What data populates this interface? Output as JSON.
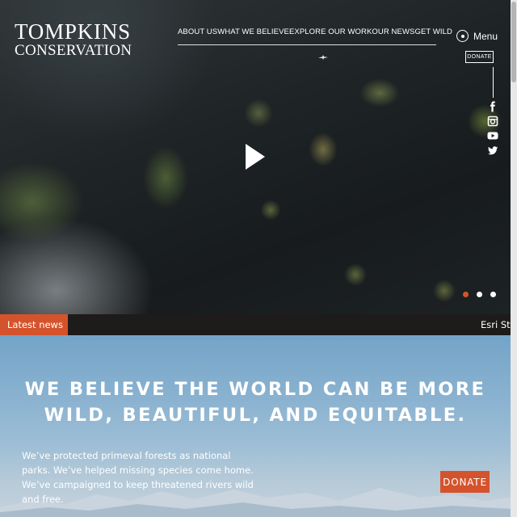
{
  "logo": {
    "line1": "TOMPKINS",
    "line2": "CONSERVATION"
  },
  "nav": {
    "items": [
      "ABOUT US",
      "WHAT WE BELIEVE",
      "EXPLORE OUR WORK",
      "OUR NEWS",
      "GET WILD"
    ]
  },
  "menu": {
    "label": "Menu"
  },
  "header_donate": {
    "label": "DONATE"
  },
  "social": {
    "icons": [
      "facebook-icon",
      "instagram-icon",
      "youtube-icon",
      "twitter-icon"
    ]
  },
  "hero": {
    "play_icon": "play-icon",
    "slides_total": 3,
    "active_slide": 1
  },
  "news": {
    "label": "Latest news",
    "ticker": "Esri St"
  },
  "intro": {
    "headline_line1": "WE BELIEVE THE WORLD CAN BE MORE",
    "headline_line2": "WILD, BEAUTIFUL, AND EQUITABLE.",
    "body": "We’ve protected primeval forests as national parks. We’ve helped missing species come home. We’ve campaigned to keep threatened rivers wild and free."
  },
  "donate_button": {
    "label": "DONATE"
  },
  "colors": {
    "accent": "#d5532c",
    "newsbar": "#1e1b1b",
    "sky": "#8ab2d0"
  }
}
